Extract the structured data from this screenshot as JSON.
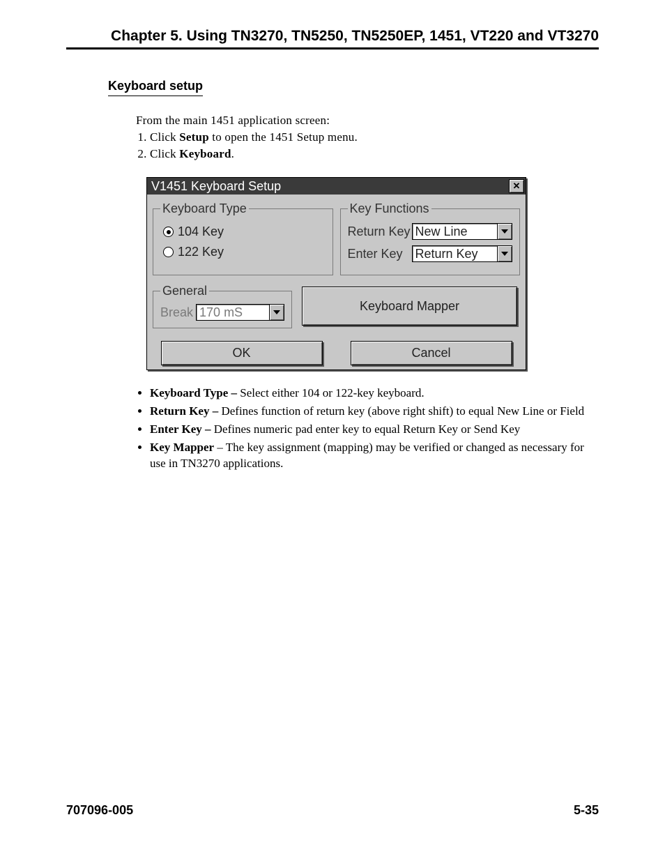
{
  "header": {
    "chapter_title": "Chapter 5.  Using  TN3270, TN5250, TN5250EP, 1451, VT220 and VT3270"
  },
  "section": {
    "title": "Keyboard setup",
    "intro": "From the main 1451 application screen:",
    "steps": [
      {
        "prefix": "Click ",
        "bold": "Setup",
        "suffix": " to open the 1451 Setup menu."
      },
      {
        "prefix": "Click ",
        "bold": "Keyboard",
        "suffix": "."
      }
    ]
  },
  "dialog": {
    "title": "V1451 Keyboard Setup",
    "close_glyph": "✕",
    "groups": {
      "keyboard_type": {
        "legend": "Keyboard Type",
        "options": [
          {
            "label": "104 Key",
            "selected": true
          },
          {
            "label": "122 Key",
            "selected": false
          }
        ]
      },
      "key_functions": {
        "legend": "Key Functions",
        "rows": [
          {
            "label": "Return Key",
            "value": "New Line"
          },
          {
            "label": "Enter Key",
            "value": "Return Key"
          }
        ]
      },
      "general": {
        "legend": "General",
        "break_label": "Break",
        "break_value": "170 mS"
      }
    },
    "buttons": {
      "mapper": "Keyboard Mapper",
      "ok": "OK",
      "cancel": "Cancel"
    }
  },
  "descriptions": [
    {
      "term": "Keyboard Type –",
      "text": " Select either 104 or 122-key keyboard."
    },
    {
      "term": "Return Key –",
      "text": " Defines function of return key (above right shift) to equal New Line or Field"
    },
    {
      "term": "Enter Key –",
      "text": " Defines numeric pad enter key to equal Return Key or Send Key"
    },
    {
      "term": "Key Mapper",
      "text": " – The key assignment (mapping) may be verified or changed as necessary for use in TN3270 applications."
    }
  ],
  "footer": {
    "doc_number": "707096-005",
    "page_number": "5-35"
  }
}
